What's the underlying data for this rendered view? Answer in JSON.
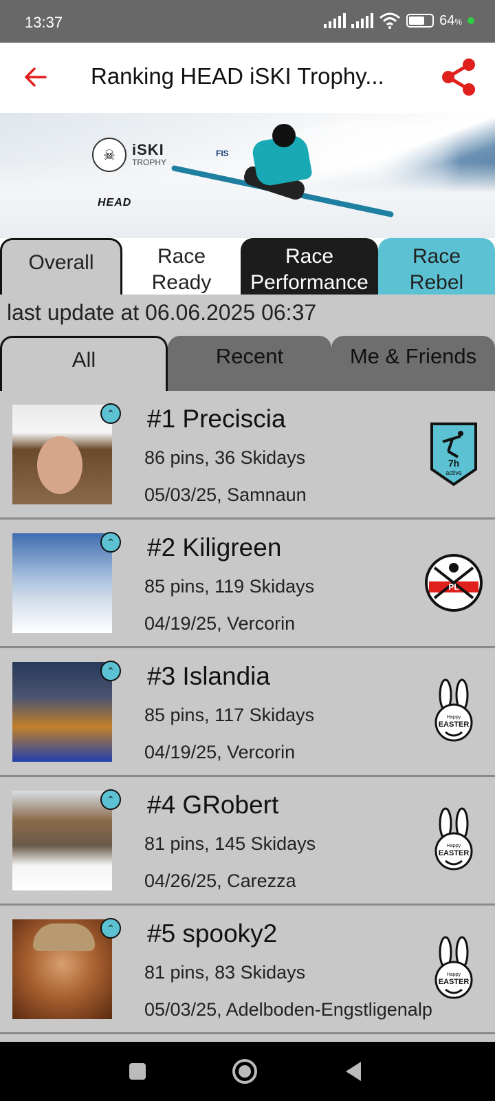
{
  "status": {
    "time": "13:37",
    "battery": "64",
    "battery_unit": "%"
  },
  "appbar": {
    "title": "Ranking HEAD iSKI Trophy..."
  },
  "banner": {
    "logo_text": "iSKI",
    "logo_sub": "TROPHY",
    "fis": "FIS",
    "brand": "HEAD"
  },
  "main_tabs": [
    {
      "label": "Overall"
    },
    {
      "label": "Race\nReady"
    },
    {
      "label": "Race\nPerformance"
    },
    {
      "label": "Race\nRebel"
    }
  ],
  "update_text": "last update at 06.06.2025 06:37",
  "filter_tabs": [
    {
      "label": "All"
    },
    {
      "label": "Recent"
    },
    {
      "label": "Me & Friends"
    }
  ],
  "ranking": [
    {
      "name": "#1 Preciscia",
      "pins": "86 pins, 36 Skidays",
      "date": "05/03/25, Samnaun",
      "badge": "7h active"
    },
    {
      "name": "#2 Kiligreen",
      "pins": "85 pins, 119 Skidays",
      "date": "04/19/25, Vercorin",
      "badge": "PL"
    },
    {
      "name": "#3 Islandia",
      "pins": "85 pins, 117 Skidays",
      "date": "04/19/25, Vercorin",
      "badge": "Happy EASTER"
    },
    {
      "name": "#4 GRobert",
      "pins": "81 pins, 145 Skidays",
      "date": "04/26/25, Carezza",
      "badge": "Happy EASTER"
    },
    {
      "name": "#5 spooky2",
      "pins": "81 pins, 83 Skidays",
      "date": "05/03/25, Adelboden-Engstligenalp",
      "badge": "Happy EASTER"
    }
  ],
  "colors": {
    "accent": "#e0201c",
    "teal": "#5cc2d3",
    "dark_tab": "#1c1c1c"
  }
}
